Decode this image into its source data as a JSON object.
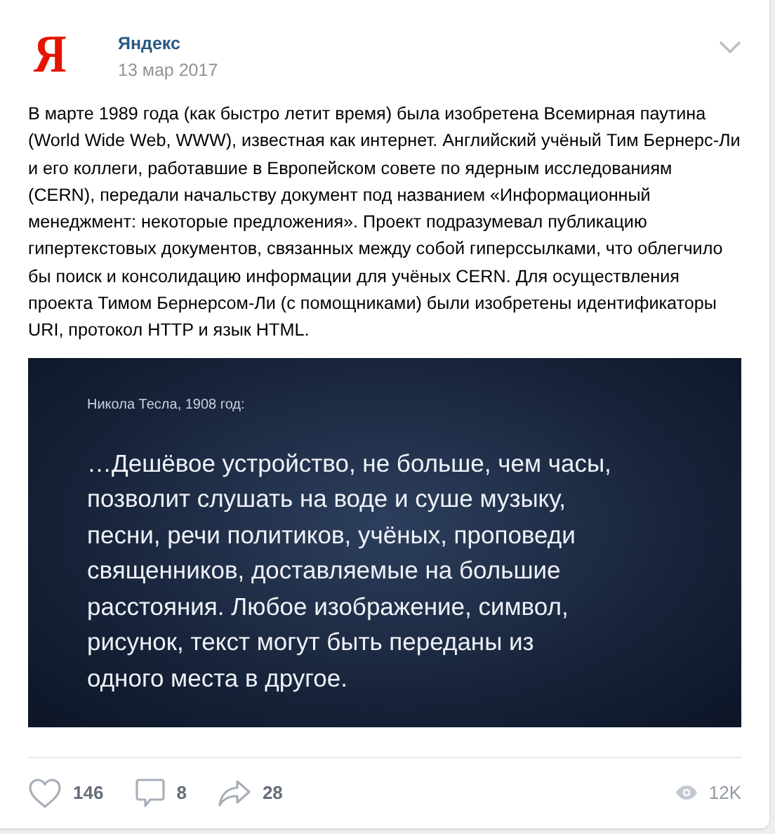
{
  "post": {
    "author": "Яндекс",
    "logo_letter": "Я",
    "date": "13 мар 2017",
    "text": "В марте 1989 года (как быстро летит время) была изобретена Всемирная паутина (World Wide Web, WWW), известная как интернет. Английский учёный Тим Бернерс-Ли и его коллеги, работавшие в Европейском совете по ядерным исследованиям (CERN), передали начальству документ под названием «Информационный менеджмент: некоторые предложения». Проект подразумевал публикацию гипертекстовых документов, связанных между собой гиперссылками, что облегчило бы поиск и консолидацию информации для учёных CERN. Для осуществления проекта Тимом Бернерсом-Ли (с помощниками) были изобретены идентификаторы URI, протокол HTTP и язык HTML.",
    "image": {
      "caption": "Никола Тесла, 1908 год:",
      "quote_lines": [
        "…Дешёвое устройство, не больше, чем часы,",
        "позволит слушать на воде и суше музыку,",
        "песни, речи политиков, учёных, проповеди",
        "священников, доставляемые на большие",
        "расстояния. Любое изображение, символ,",
        "рисунок, текст могут быть переданы из",
        "одного места в другое."
      ]
    },
    "likes": "146",
    "comments": "8",
    "shares": "28",
    "views": "12K"
  }
}
